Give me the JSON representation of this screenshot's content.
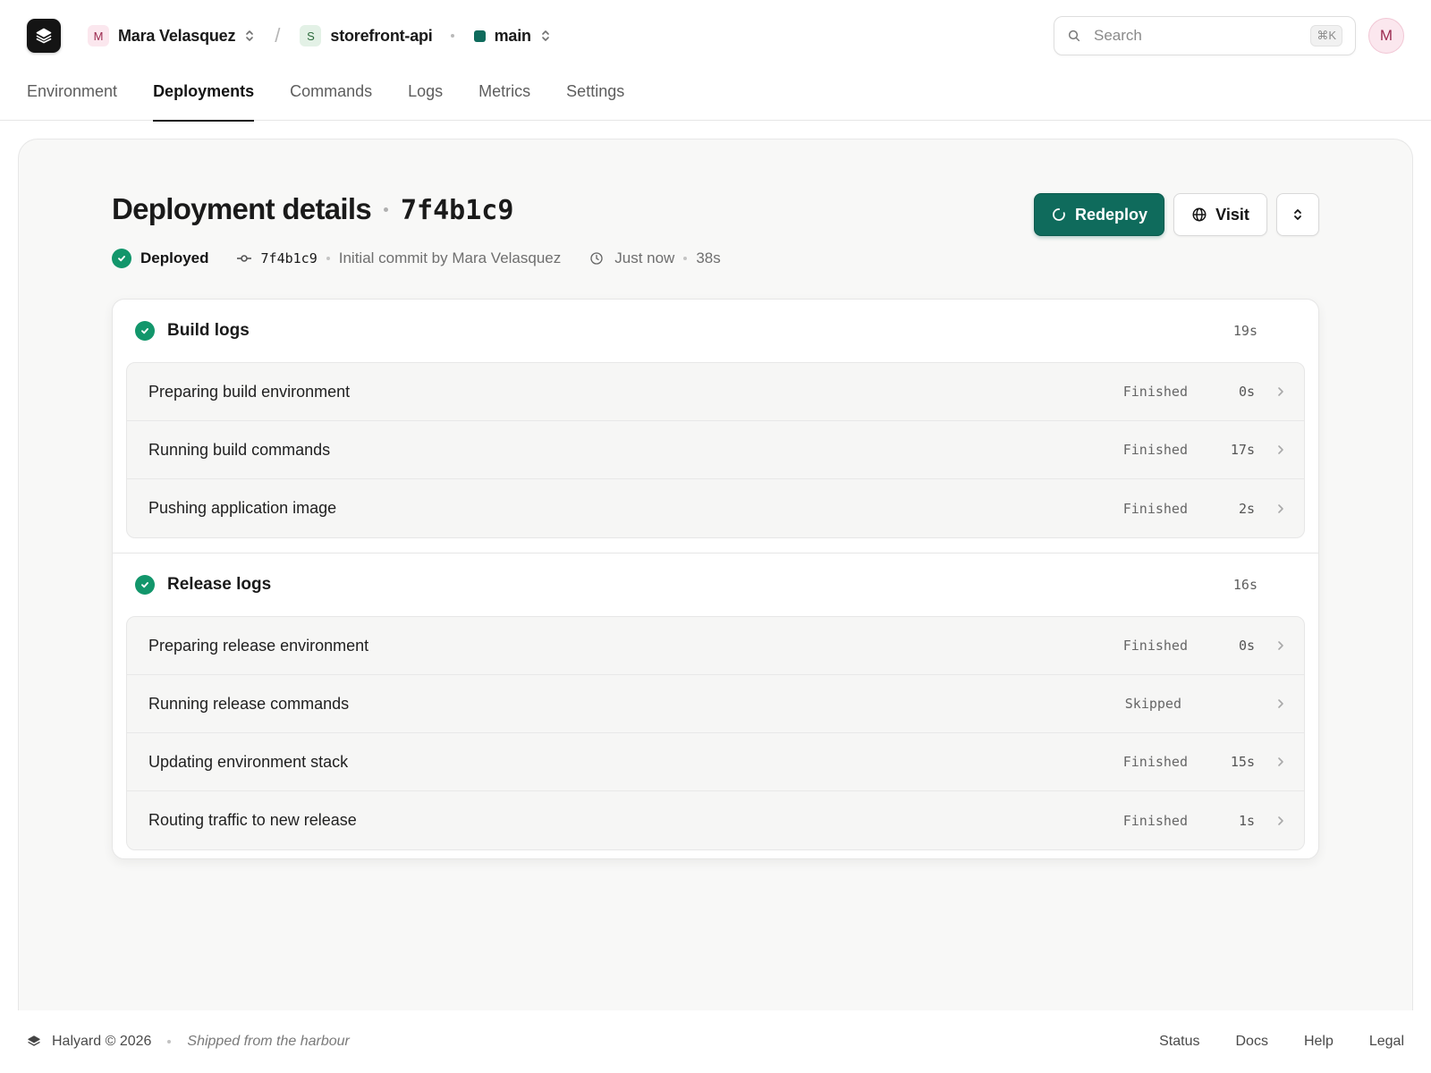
{
  "header": {
    "workspace": {
      "initial": "M",
      "name": "Mara Velasquez"
    },
    "service": {
      "initial": "S",
      "name": "storefront-api"
    },
    "branch": {
      "name": "main",
      "color": "#0f6b5c"
    },
    "search": {
      "placeholder": "Search",
      "shortcut": "⌘K"
    },
    "avatar_initial": "M"
  },
  "tabs": [
    {
      "label": "Environment",
      "active": false
    },
    {
      "label": "Deployments",
      "active": true
    },
    {
      "label": "Commands",
      "active": false
    },
    {
      "label": "Logs",
      "active": false
    },
    {
      "label": "Metrics",
      "active": false
    },
    {
      "label": "Settings",
      "active": false
    }
  ],
  "deployment": {
    "title": "Deployment details",
    "hash": "7f4b1c9",
    "status": "Deployed",
    "commit_hash": "7f4b1c9",
    "commit_message": "Initial commit by Mara Velasquez",
    "time": "Just now",
    "duration": "38s",
    "actions": {
      "redeploy": "Redeploy",
      "visit": "Visit"
    }
  },
  "logs": {
    "build": {
      "title": "Build logs",
      "total": "19s",
      "steps": [
        {
          "label": "Preparing build environment",
          "status": "Finished",
          "duration": "0s"
        },
        {
          "label": "Running build commands",
          "status": "Finished",
          "duration": "17s"
        },
        {
          "label": "Pushing application image",
          "status": "Finished",
          "duration": "2s"
        }
      ]
    },
    "release": {
      "title": "Release logs",
      "total": "16s",
      "steps": [
        {
          "label": "Preparing release environment",
          "status": "Finished",
          "duration": "0s"
        },
        {
          "label": "Running release commands",
          "status": "Skipped",
          "duration": ""
        },
        {
          "label": "Updating environment stack",
          "status": "Finished",
          "duration": "15s"
        },
        {
          "label": "Routing traffic to new release",
          "status": "Finished",
          "duration": "1s"
        }
      ]
    }
  },
  "footer": {
    "brand": "Halyard © 2026",
    "tagline": "Shipped from the harbour",
    "links": [
      "Status",
      "Docs",
      "Help",
      "Legal"
    ]
  },
  "colors": {
    "accent": "#0f6b5c",
    "success": "#12966b"
  }
}
